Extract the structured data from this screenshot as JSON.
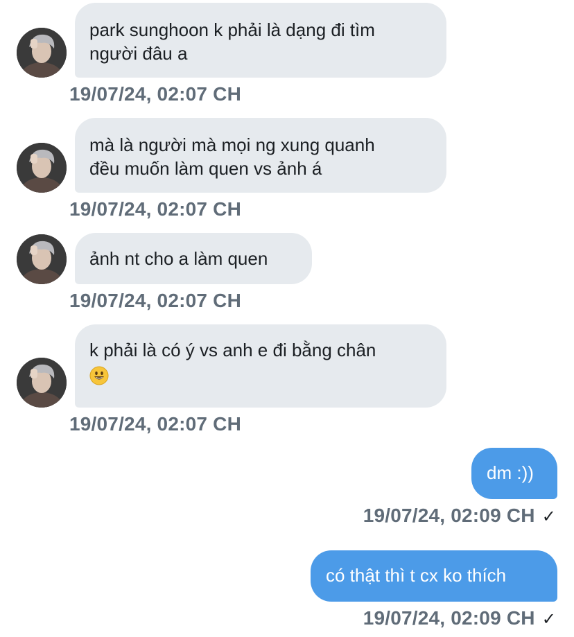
{
  "messages": [
    {
      "direction": "incoming",
      "lines": [
        "park sunghoon k phải là dạng đi tìm",
        "người đâu a"
      ],
      "timestamp": "19/07/24, 02:07 CH"
    },
    {
      "direction": "incoming",
      "lines": [
        "mà là người mà mọi ng xung quanh",
        "đều muốn làm quen vs ảnh á"
      ],
      "timestamp": "19/07/24, 02:07 CH"
    },
    {
      "direction": "incoming",
      "lines": [
        "ảnh nt cho a làm quen"
      ],
      "timestamp": "19/07/24, 02:07 CH"
    },
    {
      "direction": "incoming",
      "lines": [
        "k phải là có ý vs anh e đi bằng chân"
      ],
      "emoji": "smiley-face-emoji",
      "timestamp": "19/07/24, 02:07 CH"
    },
    {
      "direction": "outgoing",
      "lines": [
        "dm :))"
      ],
      "timestamp": "19/07/24, 02:09 CH",
      "status": "✓"
    },
    {
      "direction": "outgoing",
      "lines": [
        "có thật thì t cx ko thích"
      ],
      "timestamp": "19/07/24, 02:09 CH",
      "status": "✓"
    }
  ],
  "colors": {
    "incoming_bubble": "#e6eaee",
    "outgoing_bubble": "#4c9be8",
    "timestamp_text": "#606c78"
  }
}
